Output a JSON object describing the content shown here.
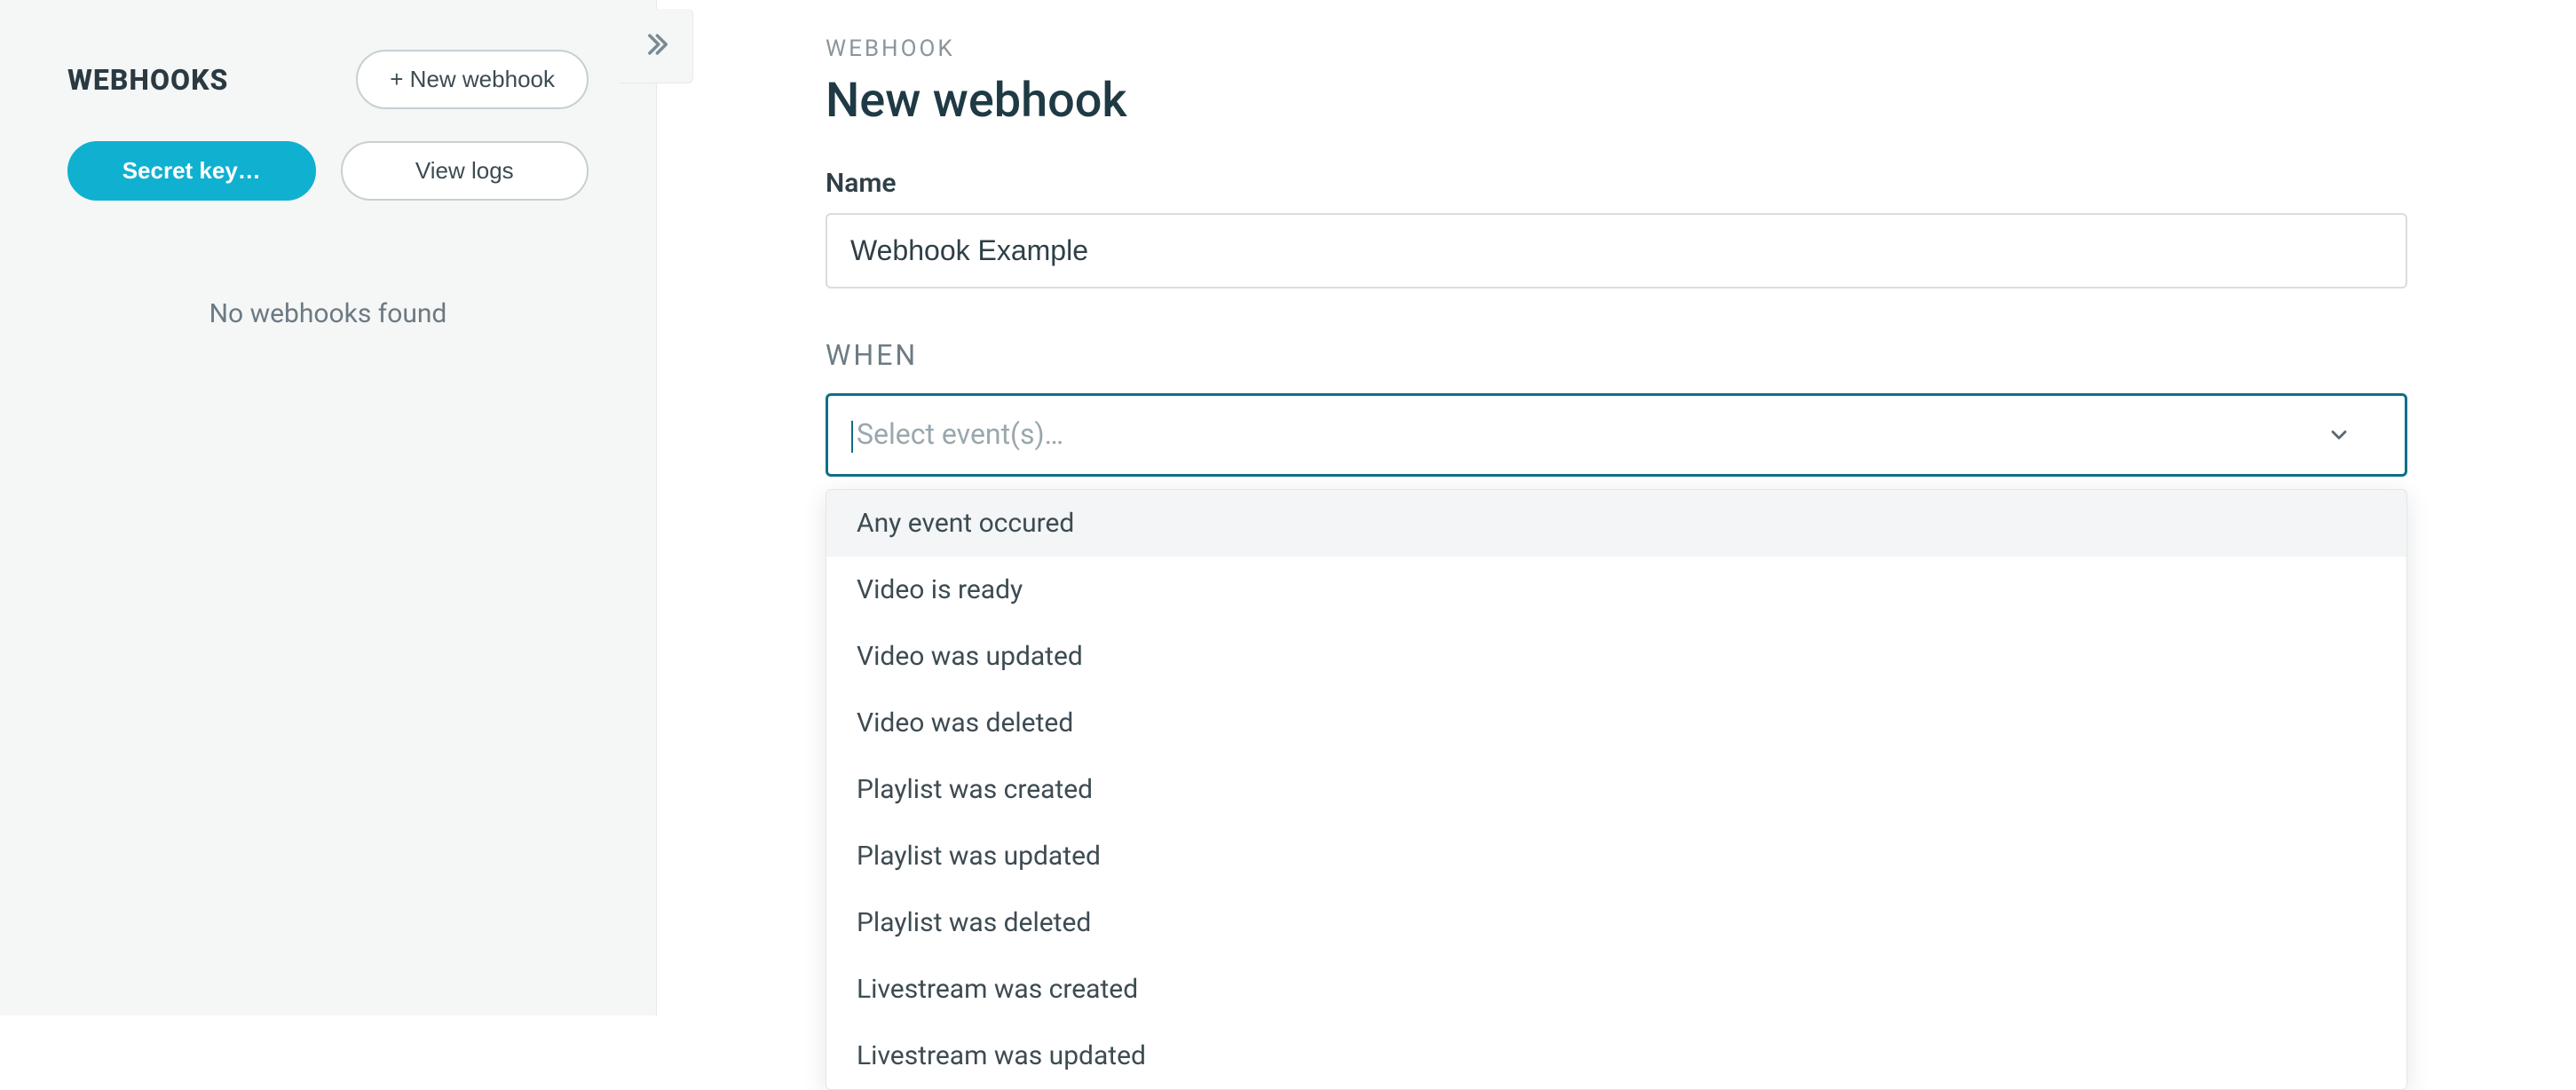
{
  "sidebar": {
    "title": "WEBHOOKS",
    "new_webhook_label": "+ New webhook",
    "secret_key_label": "Secret key…",
    "view_logs_label": "View logs",
    "empty_message": "No webhooks found"
  },
  "main": {
    "eyebrow": "WEBHOOK",
    "title": "New webhook",
    "name_label": "Name",
    "name_value": "Webhook Example",
    "when_label": "WHEN",
    "event_placeholder": "Select event(s)…",
    "event_options": [
      "Any event occured",
      "Video is ready",
      "Video was updated",
      "Video was deleted",
      "Playlist was created",
      "Playlist was updated",
      "Playlist was deleted",
      "Livestream was created",
      "Livestream was updated"
    ],
    "highlighted_index": 0
  }
}
